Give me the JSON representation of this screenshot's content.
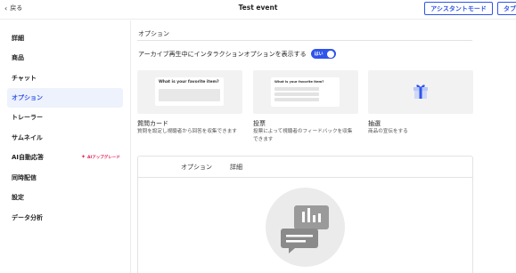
{
  "header": {
    "back_label": "戻る",
    "title": "Test event",
    "assistant_mode_label": "アシスタントモード",
    "tab_button_label": "タブ"
  },
  "sidebar": {
    "items": [
      {
        "label": "詳細",
        "active": false
      },
      {
        "label": "商品",
        "active": false
      },
      {
        "label": "チャット",
        "active": false
      },
      {
        "label": "オプション",
        "active": true
      },
      {
        "label": "トレーラー",
        "active": false
      },
      {
        "label": "サムネイル",
        "active": false
      },
      {
        "label": "AI自動応答",
        "active": false
      },
      {
        "label": "同時配信",
        "active": false
      },
      {
        "label": "設定",
        "active": false
      },
      {
        "label": "データ分析",
        "active": false
      }
    ],
    "ai_badge": "AIアップグレード"
  },
  "main": {
    "section_title": "オプション",
    "toggle_label": "アーカイブ再生中にインタラクションオプションを表示する",
    "toggle_value": "はい",
    "cards": [
      {
        "title": "質問カード",
        "description_line1": "質問を設定し視聴者から回答を収集できます",
        "description_line2": "",
        "preview_text": "What is your favorite item?"
      },
      {
        "title": "投票",
        "description_line1": "投票によって視聴者のフィードバックを収集",
        "description_line2": "できます",
        "preview_text": "What is your favorite item?"
      },
      {
        "title": "抽選",
        "description_line1": "商品の宣伝をする",
        "description_line2": "",
        "preview_text": ""
      }
    ],
    "panel": {
      "tab_options": "オプション",
      "tab_details": "詳細"
    }
  },
  "colors": {
    "accent": "#2f54eb",
    "active_bg": "#eef2fc",
    "badge": "#e0245e",
    "card_bg": "#f2f2f2"
  },
  "icons": [
    "back-chevron-icon",
    "sparkle-icon",
    "gift-icon",
    "chat-bubble-icon",
    "bar-chart-icon"
  ]
}
